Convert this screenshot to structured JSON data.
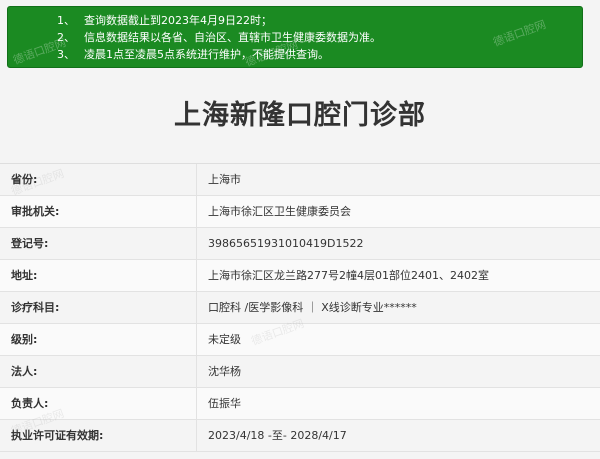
{
  "notice": {
    "items": [
      {
        "num": "1、",
        "text": "查询数据截止到2023年4月9日22时；"
      },
      {
        "num": "2、",
        "text": "信息数据结果以各省、自治区、直辖市卫生健康委数据为准。"
      },
      {
        "num": "3、",
        "text": "凌晨1点至凌晨5点系统进行维护，不能提供查询。"
      }
    ],
    "background_color": "#1b8a22"
  },
  "page_title": "上海新隆口腔门诊部",
  "watermark_text": "德语口腔网",
  "rows": [
    {
      "label": "省份:",
      "value": "上海市"
    },
    {
      "label": "审批机关:",
      "value": "上海市徐汇区卫生健康委员会"
    },
    {
      "label": "登记号:",
      "value": "39865651931010419D1522"
    },
    {
      "label": "地址:",
      "value": "上海市徐汇区龙兰路277号2幢4层01部位2401、2402室"
    },
    {
      "label": "诊疗科目:",
      "value": "口腔科 /医学影像科 ｜ X线诊断专业******"
    },
    {
      "label": "级别:",
      "value": "未定级"
    },
    {
      "label": "法人:",
      "value": "沈华杨"
    },
    {
      "label": "负责人:",
      "value": "伍振华"
    },
    {
      "label": "执业许可证有效期:",
      "value": "2023/4/18 -至- 2028/4/17"
    }
  ]
}
